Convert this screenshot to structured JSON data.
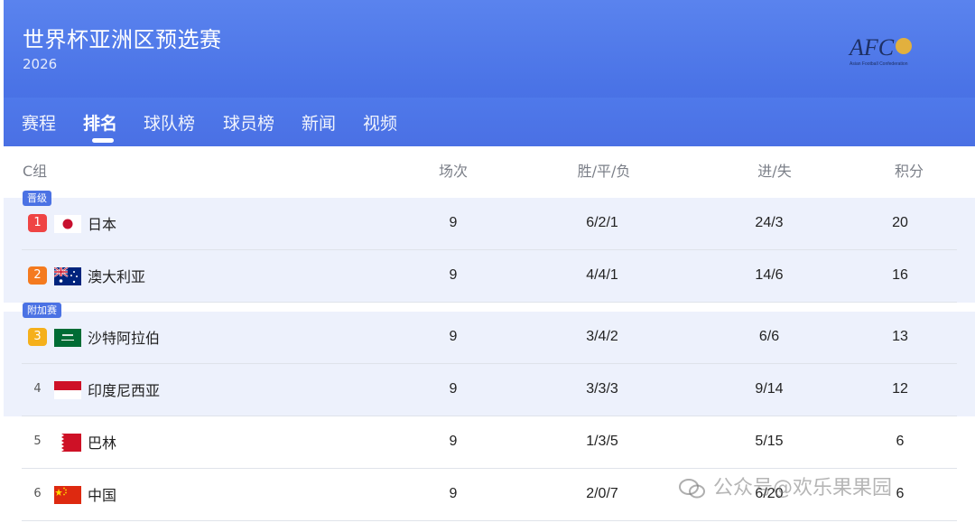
{
  "header": {
    "title": "世界杯亚洲区预选赛",
    "year": "2026",
    "logo_text": "AFC",
    "logo_subtext": "Asian Football Confederation"
  },
  "tabs": [
    "赛程",
    "排名",
    "球队榜",
    "球员榜",
    "新闻",
    "视频"
  ],
  "active_tab": "排名",
  "table": {
    "group_label": "C组",
    "columns": {
      "played": "场次",
      "wdl": "胜/平/负",
      "goals": "进/失",
      "points": "积分"
    },
    "badges": {
      "qualified": "晋级",
      "playoff": "附加赛"
    },
    "rows": [
      {
        "rank": "1",
        "team": "日本",
        "played": "9",
        "wdl": "6/2/1",
        "goals": "24/3",
        "points": "20",
        "flag": "japan",
        "rank_color": "#ef4444"
      },
      {
        "rank": "2",
        "team": "澳大利亚",
        "played": "9",
        "wdl": "4/4/1",
        "goals": "14/6",
        "points": "16",
        "flag": "australia",
        "rank_color": "#f47a1f"
      },
      {
        "rank": "3",
        "team": "沙特阿拉伯",
        "played": "9",
        "wdl": "3/4/2",
        "goals": "6/6",
        "points": "13",
        "flag": "saudi-arabia",
        "rank_color": "#f5b01c"
      },
      {
        "rank": "4",
        "team": "印度尼西亚",
        "played": "9",
        "wdl": "3/3/3",
        "goals": "9/14",
        "points": "12",
        "flag": "indonesia"
      },
      {
        "rank": "5",
        "team": "巴林",
        "played": "9",
        "wdl": "1/3/5",
        "goals": "5/15",
        "points": "6",
        "flag": "bahrain"
      },
      {
        "rank": "6",
        "team": "中国",
        "played": "9",
        "wdl": "2/0/7",
        "goals": "6/20",
        "points": "6",
        "flag": "china"
      }
    ]
  },
  "watermark": "公众号@欢乐果果园",
  "colors": {
    "header_blue": "#4a73e6",
    "row_highlight": "#edf1fc",
    "badge_blue": "#4b72e4"
  }
}
